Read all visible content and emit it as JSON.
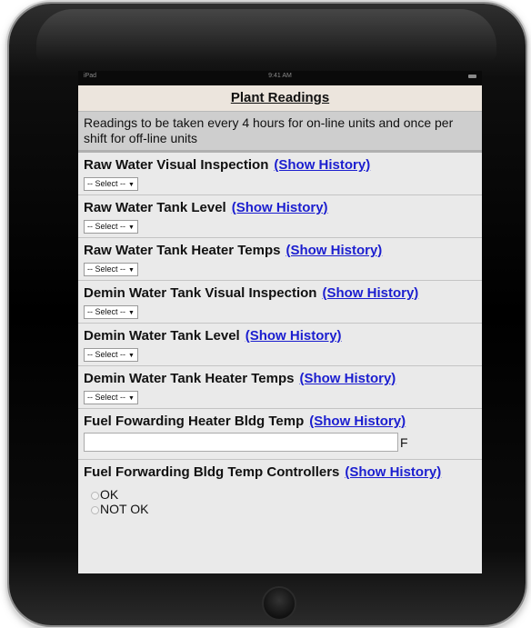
{
  "status_bar": {
    "carrier": "iPad",
    "time": "9:41 AM"
  },
  "page_title": "Plant Readings",
  "notice": "Readings to be taken every 4 hours for on-line units and once per shift for off-line units",
  "history_label": "(Show History)",
  "select_placeholder": "-- Select --",
  "items": [
    {
      "label": "Raw Water Visual Inspection"
    },
    {
      "label": "Raw Water Tank Level"
    },
    {
      "label": "Raw Water Tank Heater Temps"
    },
    {
      "label": "Demin Water Tank Visual Inspection"
    },
    {
      "label": "Demin Water Tank Level"
    },
    {
      "label": "Demin Water Tank Heater Temps"
    },
    {
      "label": "Fuel Fowarding Heater Bldg Temp",
      "value": "",
      "unit": "F"
    },
    {
      "label": "Fuel Forwarding Bldg Temp Controllers",
      "options": [
        "OK",
        "NOT OK"
      ]
    }
  ]
}
